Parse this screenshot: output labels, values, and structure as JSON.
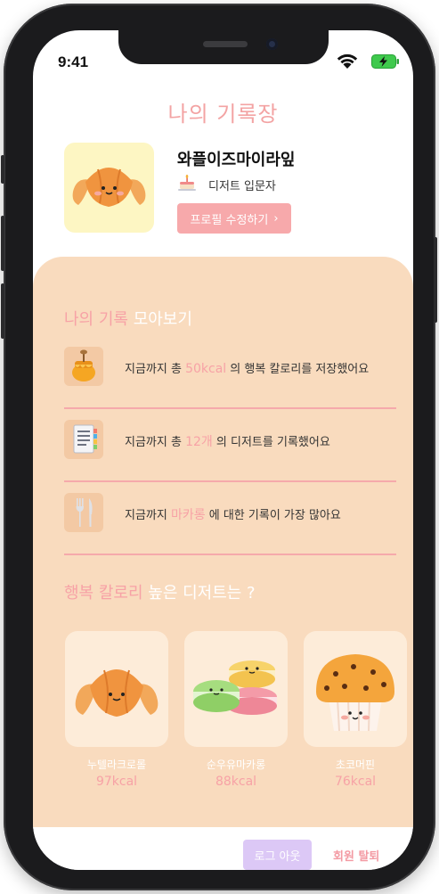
{
  "status_bar": {
    "time": "9:41",
    "wifi_icon": "wifi-icon",
    "battery_icon": "battery-charging-icon"
  },
  "header": {
    "title": "나의 기록장"
  },
  "profile": {
    "nickname": "와플이즈마이라잎",
    "level_icon": "cake-icon",
    "level": "디저트 입문자",
    "edit_label": "프로필 수정하기",
    "edit_chevron": "›",
    "avatar_icon": "croissant-icon"
  },
  "records": {
    "title_accent": "나의 기록",
    "title_rest": " 모아보기",
    "items": [
      {
        "icon": "honey-pot-icon",
        "prefix": "지금까지 총 ",
        "highlight": "50kcal",
        "suffix": " 의 행복 칼로리를 저장했어요"
      },
      {
        "icon": "notepad-icon",
        "prefix": "지금까지 총 ",
        "highlight": "12개",
        "suffix": " 의 디저트를 기록했어요"
      },
      {
        "icon": "fork-knife-icon",
        "prefix": "지금까지 ",
        "highlight": "마카롱",
        "suffix": " 에 대한 기록이 가장 많아요"
      }
    ]
  },
  "top_desserts": {
    "title_accent": "행복 칼로리",
    "title_rest": " 높은 디저트는 ?",
    "items": [
      {
        "icon": "croissant-icon",
        "name": "누텔라크로롤",
        "kcal": "97kcal"
      },
      {
        "icon": "macaron-icon",
        "name": "순우유마카롱",
        "kcal": "88kcal"
      },
      {
        "icon": "muffin-icon",
        "name": "초코머핀",
        "kcal": "76kcal"
      }
    ]
  },
  "footer": {
    "logout_label": "로그 아웃",
    "withdraw_label": "회원 탈퇴"
  },
  "colors": {
    "accent_pink": "#f7a2a6",
    "panel": "#f9dbbe",
    "logout_purple": "#dcc8f6"
  }
}
